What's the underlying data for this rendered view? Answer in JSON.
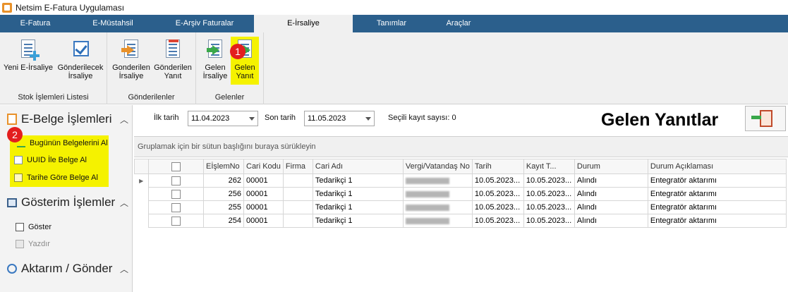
{
  "window": {
    "title": "Netsim E-Fatura Uygulaması"
  },
  "tabs": [
    {
      "label": "E-Fatura"
    },
    {
      "label": "E-Müstahsil"
    },
    {
      "label": "E-Arşiv Faturalar"
    },
    {
      "label": "E-İrsaliye",
      "active": true
    },
    {
      "label": "Tanımlar"
    },
    {
      "label": "Araçlar"
    }
  ],
  "ribbon": {
    "groups": [
      {
        "label": "Stok İşlemleri Listesi",
        "buttons": [
          {
            "line1": "Yeni E-İrsaliye",
            "line2": "",
            "icon": "new-doc-icon"
          },
          {
            "line1": "Gönderilecek",
            "line2": "İrsaliye",
            "icon": "checkbox-icon"
          }
        ]
      },
      {
        "label": "Gönderilenler",
        "buttons": [
          {
            "line1": "Gonderilen",
            "line2": "İrsaliye",
            "icon": "send-doc-icon"
          },
          {
            "line1": "Gönderilen",
            "line2": "Yanıt",
            "icon": "reply-doc-icon"
          }
        ]
      },
      {
        "label": "Gelenler",
        "buttons": [
          {
            "line1": "Gelen",
            "line2": "İrsaliye",
            "icon": "incoming-doc-icon"
          },
          {
            "line1": "Gelen",
            "line2": "Yanıt",
            "icon": "incoming-reply-icon"
          }
        ]
      }
    ]
  },
  "callouts": {
    "one": "1",
    "two": "2"
  },
  "leftpanel": {
    "sections": [
      {
        "title": "E-Belge İşlemleri",
        "items": [
          "Bugünün Belgelerini Al",
          "UUID İle Belge Al",
          "Tarihe Göre Belge Al"
        ]
      },
      {
        "title": "Gösterim İşlemler",
        "items": [
          "Göster",
          "Yazdır"
        ]
      },
      {
        "title": "Aktarım / Gönder",
        "items": []
      }
    ]
  },
  "filter": {
    "start_label": "İlk tarih",
    "start_value": "11.04.2023",
    "end_label": "Son tarih",
    "end_value": "11.05.2023",
    "count_label": "Seçili kayıt sayısı: 0"
  },
  "page_title": "Gelen Yanıtlar",
  "grid": {
    "group_hint": "Gruplamak için bir sütun başlığını buraya sürükleyin",
    "columns": [
      "EİşlemNo",
      "Cari Kodu",
      "Firma",
      "Cari Adı",
      "Vergi/Vatandaş No",
      "Tarih",
      "Kayıt T...",
      "Durum",
      "Durum Açıklaması"
    ],
    "rows": [
      {
        "no": "262",
        "cari_kodu": "00001",
        "firma": "",
        "cari_adi": "Tedarikçi 1",
        "tarih": "10.05.2023...",
        "kayit": "10.05.2023...",
        "durum": "Alındı",
        "aciklama": "Entegratör aktarımı"
      },
      {
        "no": "256",
        "cari_kodu": "00001",
        "firma": "",
        "cari_adi": "Tedarikçi 1",
        "tarih": "10.05.2023...",
        "kayit": "10.05.2023...",
        "durum": "Alındı",
        "aciklama": "Entegratör aktarımı"
      },
      {
        "no": "255",
        "cari_kodu": "00001",
        "firma": "",
        "cari_adi": "Tedarikçi 1",
        "tarih": "10.05.2023...",
        "kayit": "10.05.2023...",
        "durum": "Alındı",
        "aciklama": "Entegratör aktarımı"
      },
      {
        "no": "254",
        "cari_kodu": "00001",
        "firma": "",
        "cari_adi": "Tedarikçi 1",
        "tarih": "10.05.2023...",
        "kayit": "10.05.2023...",
        "durum": "Alındı",
        "aciklama": "Entegratör aktarımı"
      }
    ]
  },
  "colors": {
    "tabbar": "#2b5f8c",
    "highlight": "#f5f200",
    "callout": "#e31e1e"
  }
}
